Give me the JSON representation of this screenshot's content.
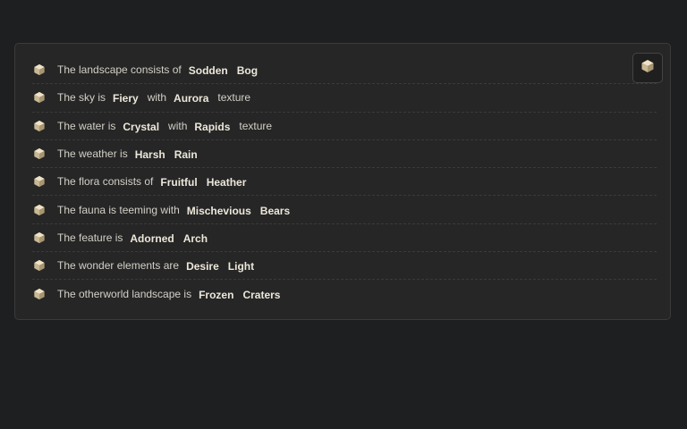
{
  "rows": [
    {
      "parts": [
        {
          "t": "text",
          "v": "The landscape consists of"
        },
        {
          "t": "kw",
          "v": "Sodden"
        },
        {
          "t": "kw",
          "v": "Bog"
        }
      ]
    },
    {
      "parts": [
        {
          "t": "text",
          "v": "The sky is"
        },
        {
          "t": "kw",
          "v": "Fiery"
        },
        {
          "t": "text",
          "v": "with"
        },
        {
          "t": "kw",
          "v": "Aurora"
        },
        {
          "t": "text",
          "v": "texture"
        }
      ]
    },
    {
      "parts": [
        {
          "t": "text",
          "v": "The water is"
        },
        {
          "t": "kw",
          "v": "Crystal"
        },
        {
          "t": "text",
          "v": "with"
        },
        {
          "t": "kw",
          "v": "Rapids"
        },
        {
          "t": "text",
          "v": "texture"
        }
      ]
    },
    {
      "parts": [
        {
          "t": "text",
          "v": "The weather is"
        },
        {
          "t": "kw",
          "v": "Harsh"
        },
        {
          "t": "kw",
          "v": "Rain"
        }
      ]
    },
    {
      "parts": [
        {
          "t": "text",
          "v": "The flora consists of"
        },
        {
          "t": "kw",
          "v": "Fruitful"
        },
        {
          "t": "kw",
          "v": "Heather"
        }
      ]
    },
    {
      "parts": [
        {
          "t": "text",
          "v": "The fauna is teeming with"
        },
        {
          "t": "kw",
          "v": "Mischevious"
        },
        {
          "t": "kw",
          "v": "Bears"
        }
      ]
    },
    {
      "parts": [
        {
          "t": "text",
          "v": "The feature is"
        },
        {
          "t": "kw",
          "v": "Adorned"
        },
        {
          "t": "kw",
          "v": "Arch"
        }
      ]
    },
    {
      "parts": [
        {
          "t": "text",
          "v": "The wonder elements are"
        },
        {
          "t": "kw",
          "v": "Desire"
        },
        {
          "t": "kw",
          "v": "Light"
        }
      ]
    },
    {
      "parts": [
        {
          "t": "text",
          "v": "The otherworld landscape is"
        },
        {
          "t": "kw",
          "v": "Frozen"
        },
        {
          "t": "kw",
          "v": "Craters"
        }
      ]
    }
  ],
  "icons": {
    "row_icon": "cube-icon",
    "reroll_button_icon": "cube-icon"
  },
  "colors": {
    "background": "#1d1f20",
    "panel": "#262626",
    "text": "#d3d0c8",
    "keyword": "#ece7da",
    "icon": "#d8cbb0"
  }
}
